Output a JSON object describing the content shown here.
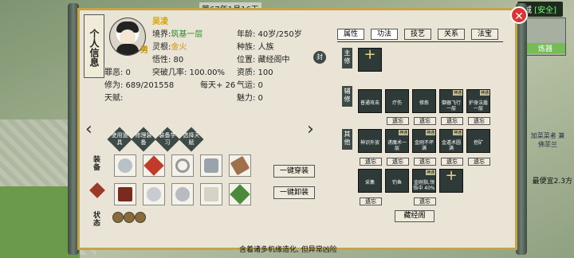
{
  "top": {
    "date": "第67年1月16天",
    "city_status_prefix": "城",
    "city_status_safe": "[安全]",
    "minimap_label": "炼器",
    "side_npc_text": "加菜菜者 兼佛菲兰",
    "side_tip": "最便宜2.3方"
  },
  "ribbon": {
    "title": "个人信息"
  },
  "profile": {
    "name": "吴凌",
    "gender": "男",
    "realm_label": "境界:",
    "realm_value": "筑基一层",
    "spirit_root_label": "灵根:",
    "spirit_root_value": "金火",
    "comprehension": "悟性: 80",
    "crime": "罪恶: 0",
    "breakthrough": "突破几率: 100.00%",
    "cultivation": "修为: 689/201558",
    "per_day": "每天+ 26",
    "talent": "天赋:",
    "age": "年龄: 40岁/250岁",
    "race": "种族: 人族",
    "location": "位置: 藏经阁中",
    "aptitude": "资质: 100",
    "luck": "气运: 0",
    "charm": "魅力: 0",
    "seal_badge": "封"
  },
  "skill_buttons": [
    {
      "label": "使用道具"
    },
    {
      "label": "修理装备"
    },
    {
      "label": "装备学习"
    },
    {
      "label": "选择天赋"
    }
  ],
  "equipment": {
    "label": "装备",
    "equip_all": "一键穿装",
    "unequip_all": "一键卸装",
    "status_label": "状态"
  },
  "tabs": [
    {
      "label": "属性",
      "active": false
    },
    {
      "label": "功法",
      "active": true
    },
    {
      "label": "技艺",
      "active": false
    },
    {
      "label": "关系",
      "active": false
    },
    {
      "label": "法宝",
      "active": false
    }
  ],
  "sections": {
    "main": "主修",
    "aux": "辅修",
    "other": "其他"
  },
  "main_skill": {
    "name": "+"
  },
  "aux_skills": [
    {
      "tag": "",
      "name": "普通攻击"
    },
    {
      "tag": "",
      "name": "疗伤"
    },
    {
      "tag": "",
      "name": "修炼"
    },
    {
      "tag": "神通",
      "name": "御器飞行一层"
    },
    {
      "tag": "神通",
      "name": "护身法盾一层"
    }
  ],
  "other_skills_row1": [
    {
      "tag": "",
      "name": "神识外放"
    },
    {
      "tag": "神通",
      "name": "诱魔术一层"
    },
    {
      "tag": "神通",
      "name": "金刚不坏满"
    },
    {
      "tag": "神通",
      "name": "金遁术圆满"
    },
    {
      "tag": "",
      "name": "挖矿"
    }
  ],
  "other_skills_row2": [
    {
      "tag": "",
      "name": "采集"
    },
    {
      "tag": "",
      "name": "钓鱼"
    },
    {
      "tag": "神通",
      "name": "金刚指,领悟中 40%"
    },
    {
      "tag": "",
      "name": "+"
    }
  ],
  "forget_label": "遗忘",
  "scripture_button": "藏经阁",
  "bottom_text": "含着诸多机缘造化, 但异常凶险"
}
